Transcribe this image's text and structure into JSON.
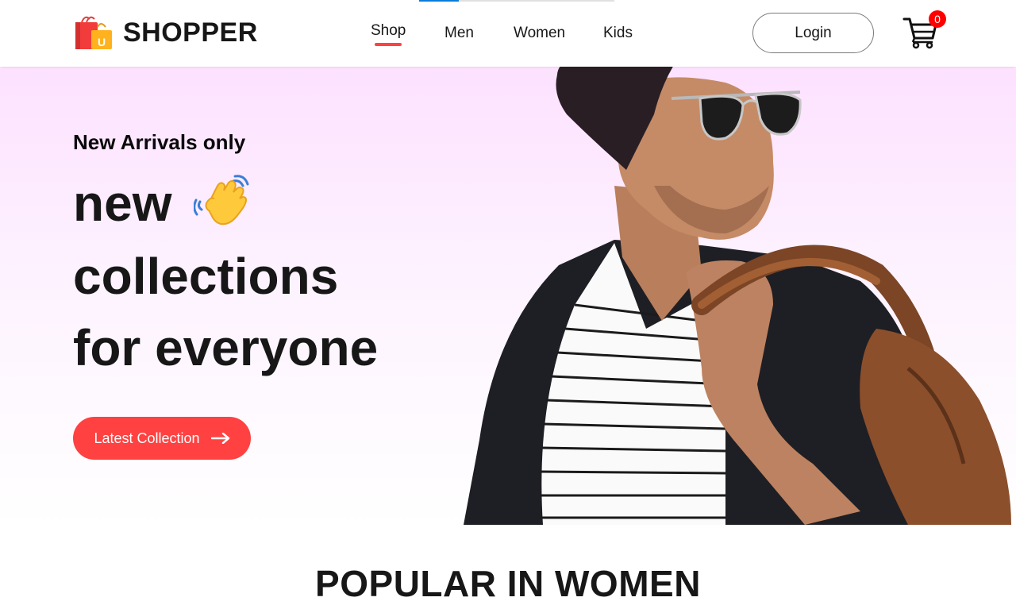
{
  "brand": {
    "name": "SHOPPER",
    "logo_icon": "shopping-bag-icon",
    "bag_letter": "U"
  },
  "nav": {
    "items": [
      {
        "label": "Shop",
        "active": true
      },
      {
        "label": "Men",
        "active": false
      },
      {
        "label": "Women",
        "active": false
      },
      {
        "label": "Kids",
        "active": false
      }
    ],
    "login_label": "Login",
    "cart_icon": "cart-icon",
    "cart_count": "0"
  },
  "hero": {
    "eyebrow": "New Arrivals only",
    "line1": "new",
    "line2": "collections",
    "line3": "for everyone",
    "hand_icon": "waving-hand-icon",
    "cta_label": "Latest Collection",
    "cta_icon": "arrow-right-icon",
    "image": "man-with-leather-bag-photo"
  },
  "popular": {
    "title": "POPULAR IN WOMEN"
  },
  "colors": {
    "accent": "#ff4141",
    "hero_top": "#fde1ff",
    "text": "#171717",
    "badge": "#ff0000"
  }
}
